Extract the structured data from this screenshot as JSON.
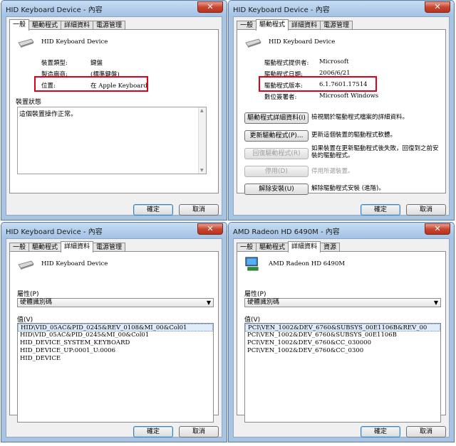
{
  "windows": [
    {
      "title": "HID Keyboard Device - 內容",
      "tabs": [
        "一般",
        "驅動程式",
        "詳細資料",
        "電源管理"
      ],
      "active_tab": 0,
      "device_name": "HID Keyboard Device",
      "fields": [
        {
          "label": "裝置類型:",
          "value": "鍵盤"
        },
        {
          "label": "製造廠商:",
          "value": "(標準鍵盤)"
        },
        {
          "label": "位置:",
          "value": "在 Apple Keyboard"
        }
      ],
      "status_group_label": "裝置狀態",
      "status_text": "這個裝置操作正常。",
      "ok_label": "確定",
      "cancel_label": "取消"
    },
    {
      "title": "HID Keyboard Device - 內容",
      "tabs": [
        "一般",
        "驅動程式",
        "詳細資料",
        "電源管理"
      ],
      "active_tab": 1,
      "device_name": "HID Keyboard Device",
      "fields": [
        {
          "label": "驅動程式提供者:",
          "value": "Microsoft"
        },
        {
          "label": "驅動程式日期:",
          "value": "2006/6/21"
        },
        {
          "label": "驅動程式版本:",
          "value": "6.1.7601.17514"
        },
        {
          "label": "數位簽署者:",
          "value": "Microsoft Windows"
        }
      ],
      "buttons": [
        {
          "label": "驅動程式詳細資料(I)",
          "desc": "檢視關於驅動程式檔案的詳細資料。",
          "enabled": true
        },
        {
          "label": "更新驅動程式(P)...",
          "desc": "更新這個裝置的驅動程式軟體。",
          "enabled": true
        },
        {
          "label": "回復驅動程式(R)",
          "desc": "如果裝置在更新驅動程式後失敗，回復到之前安裝的驅動程式。",
          "enabled": false
        },
        {
          "label": "停用(D)",
          "desc": "停用所選裝置。",
          "enabled": false
        },
        {
          "label": "解除安裝(U)",
          "desc": "解除驅動程式安裝 (進階)。",
          "enabled": true
        }
      ],
      "ok_label": "確定",
      "cancel_label": "取消"
    },
    {
      "title": "HID Keyboard Device - 內容",
      "tabs": [
        "一般",
        "驅動程式",
        "詳細資料",
        "電源管理"
      ],
      "active_tab": 2,
      "device_name": "HID Keyboard Device",
      "property_label": "屬性(P)",
      "property_value": "硬體識別碼",
      "value_label": "值(V)",
      "values": [
        "HID\\VID_05AC&PID_0245&REV_0108&MI_00&Col01",
        "HID\\VID_05AC&PID_0245&MI_00&Col01",
        "HID_DEVICE_SYSTEM_KEYBOARD",
        "HID_DEVICE_UP:0001_U:0006",
        "HID_DEVICE"
      ],
      "ok_label": "確定",
      "cancel_label": "取消"
    },
    {
      "title": "AMD Radeon HD 6490M - 內容",
      "tabs": [
        "一般",
        "驅動程式",
        "詳細資料",
        "資源"
      ],
      "active_tab": 2,
      "device_name": "AMD Radeon HD 6490M",
      "property_label": "屬性(P)",
      "property_value": "硬體識別碼",
      "value_label": "值(V)",
      "values": [
        "PCI\\VEN_1002&DEV_6760&SUBSYS_00E1106B&REV_00",
        "PCI\\VEN_1002&DEV_6760&SUBSYS_00E1106B",
        "PCI\\VEN_1002&DEV_6760&CC_030000",
        "PCI\\VEN_1002&DEV_6760&CC_0300"
      ],
      "ok_label": "確定",
      "cancel_label": "取消"
    }
  ]
}
